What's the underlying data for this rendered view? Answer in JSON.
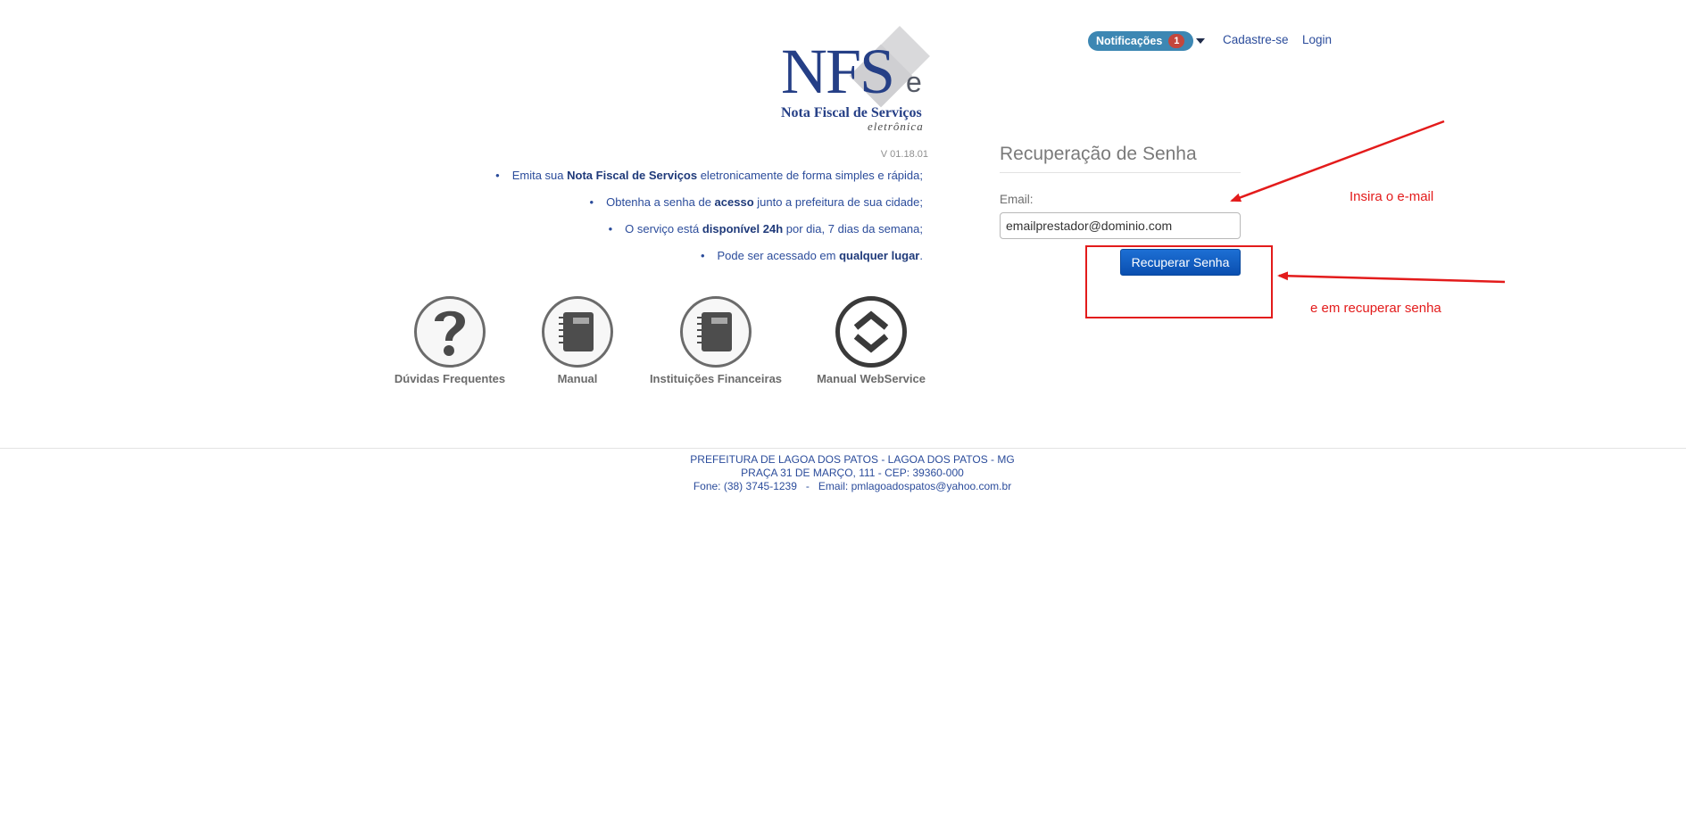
{
  "nav": {
    "notifications_label": "Notificações",
    "notifications_count": "1",
    "signup_label": "Cadastre-se",
    "login_label": "Login"
  },
  "logo": {
    "main": "NFS",
    "suffix": "e",
    "subtitle": "Nota Fiscal de Serviços",
    "tagline": "eletrônica"
  },
  "version": "V 01.18.01",
  "features": [
    {
      "pre": "Emita sua ",
      "bold": "Nota Fiscal de Serviços",
      "post": " eletronicamente de forma simples e rápida;"
    },
    {
      "pre": "Obtenha a senha de ",
      "bold": "acesso",
      "post": " junto a prefeitura de sua cidade;"
    },
    {
      "pre": "O serviço está ",
      "bold": "disponível 24h",
      "post": " por dia, 7 dias da semana;"
    },
    {
      "pre": "Pode ser acessado em ",
      "bold": "qualquer lugar",
      "post": "."
    }
  ],
  "tiles": [
    {
      "label": "Dúvidas Frequentes",
      "icon": "question-icon"
    },
    {
      "label": "Manual",
      "icon": "notebook-icon"
    },
    {
      "label": "Instituições Financeiras",
      "icon": "notebook-icon"
    },
    {
      "label": "Manual WebService",
      "icon": "chevrons-icon"
    }
  ],
  "form": {
    "title": "Recuperação de Senha",
    "email_label": "Email:",
    "email_value": "emailprestador@dominio.com",
    "submit_label": "Recuperar Senha"
  },
  "annotations": {
    "email_hint": "Insira o e-mail",
    "button_hint": "e em recuperar senha"
  },
  "footer": {
    "line1": "PREFEITURA DE LAGOA DOS PATOS - LAGOA DOS PATOS - MG",
    "line2": "PRAÇA 31 DE MARÇO, 111 - CEP: 39360-000",
    "line3": "Fone: (38) 3745-1239   -   Email: pmlagoadospatos@yahoo.com.br"
  },
  "colors": {
    "brand_blue": "#253f86",
    "notification_pill": "#3d87b3",
    "badge_red": "#c4473c",
    "annotation_red": "#e31b1b",
    "button_blue": "#0a4fb0"
  }
}
